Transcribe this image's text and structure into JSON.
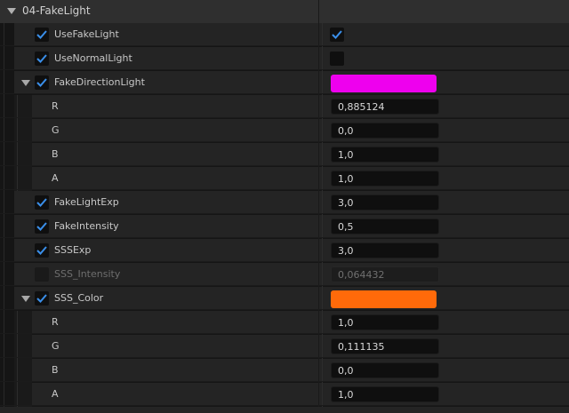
{
  "section": {
    "title": "04-FakeLight"
  },
  "colors": {
    "check": "#3a8fea",
    "fake_direction_light": "#ee00ee",
    "sss_color": "#ff6a0a"
  },
  "rows": {
    "use_fake_light": {
      "label": "UseFakeLight",
      "enabled": true,
      "value": true
    },
    "use_normal_light": {
      "label": "UseNormalLight",
      "enabled": true,
      "value": false
    },
    "fake_direction_light": {
      "label": "FakeDirectionLight",
      "enabled": true,
      "expanded": true,
      "r_label": "R",
      "r": "0,885124",
      "g_label": "G",
      "g": "0,0",
      "b_label": "B",
      "b": "1,0",
      "a_label": "A",
      "a": "1,0"
    },
    "fake_light_exp": {
      "label": "FakeLightExp",
      "enabled": true,
      "value": "3,0"
    },
    "fake_intensity": {
      "label": "FakeIntensity",
      "enabled": true,
      "value": "0,5"
    },
    "sss_exp": {
      "label": "SSSExp",
      "enabled": true,
      "value": "3,0"
    },
    "sss_intensity": {
      "label": "SSS_Intensity",
      "enabled": false,
      "value": "0,064432"
    },
    "sss_color": {
      "label": "SSS_Color",
      "enabled": true,
      "expanded": true,
      "r_label": "R",
      "r": "1,0",
      "g_label": "G",
      "g": "0,111135",
      "b_label": "B",
      "b": "0,0",
      "a_label": "A",
      "a": "1,0"
    }
  }
}
